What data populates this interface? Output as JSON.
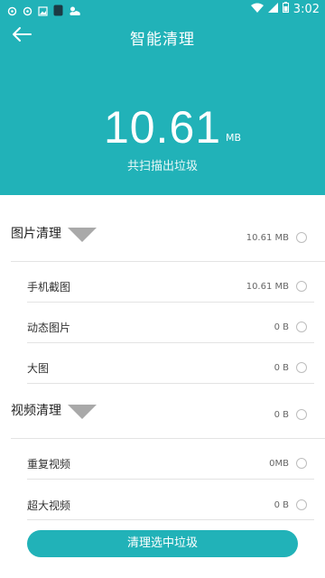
{
  "status_bar": {
    "time": "3:02",
    "icons": [
      "notification-icon",
      "notification-icon",
      "image-icon",
      "app-icon",
      "weather-icon",
      "wifi-icon",
      "signal-icon",
      "battery-icon"
    ]
  },
  "header": {
    "title": "智能清理",
    "total_size": "10.61",
    "total_unit": "MB",
    "caption": "共扫描出垃圾"
  },
  "sections": {
    "images": {
      "title": "图片清理",
      "size": "10.61 MB",
      "items": [
        {
          "label": "手机截图",
          "size": "10.61 MB"
        },
        {
          "label": "动态图片",
          "size": "0 B"
        },
        {
          "label": "大图",
          "size": "0 B"
        }
      ]
    },
    "videos": {
      "title": "视频清理",
      "size": "0 B",
      "items": [
        {
          "label": "重复视频",
          "size": "0MB"
        },
        {
          "label": "超大视频",
          "size": "0 B"
        }
      ]
    }
  },
  "actions": {
    "clean_label": "清理选中垃圾"
  },
  "colors": {
    "accent": "#21b2b8",
    "divider": "#e3e3e3"
  }
}
